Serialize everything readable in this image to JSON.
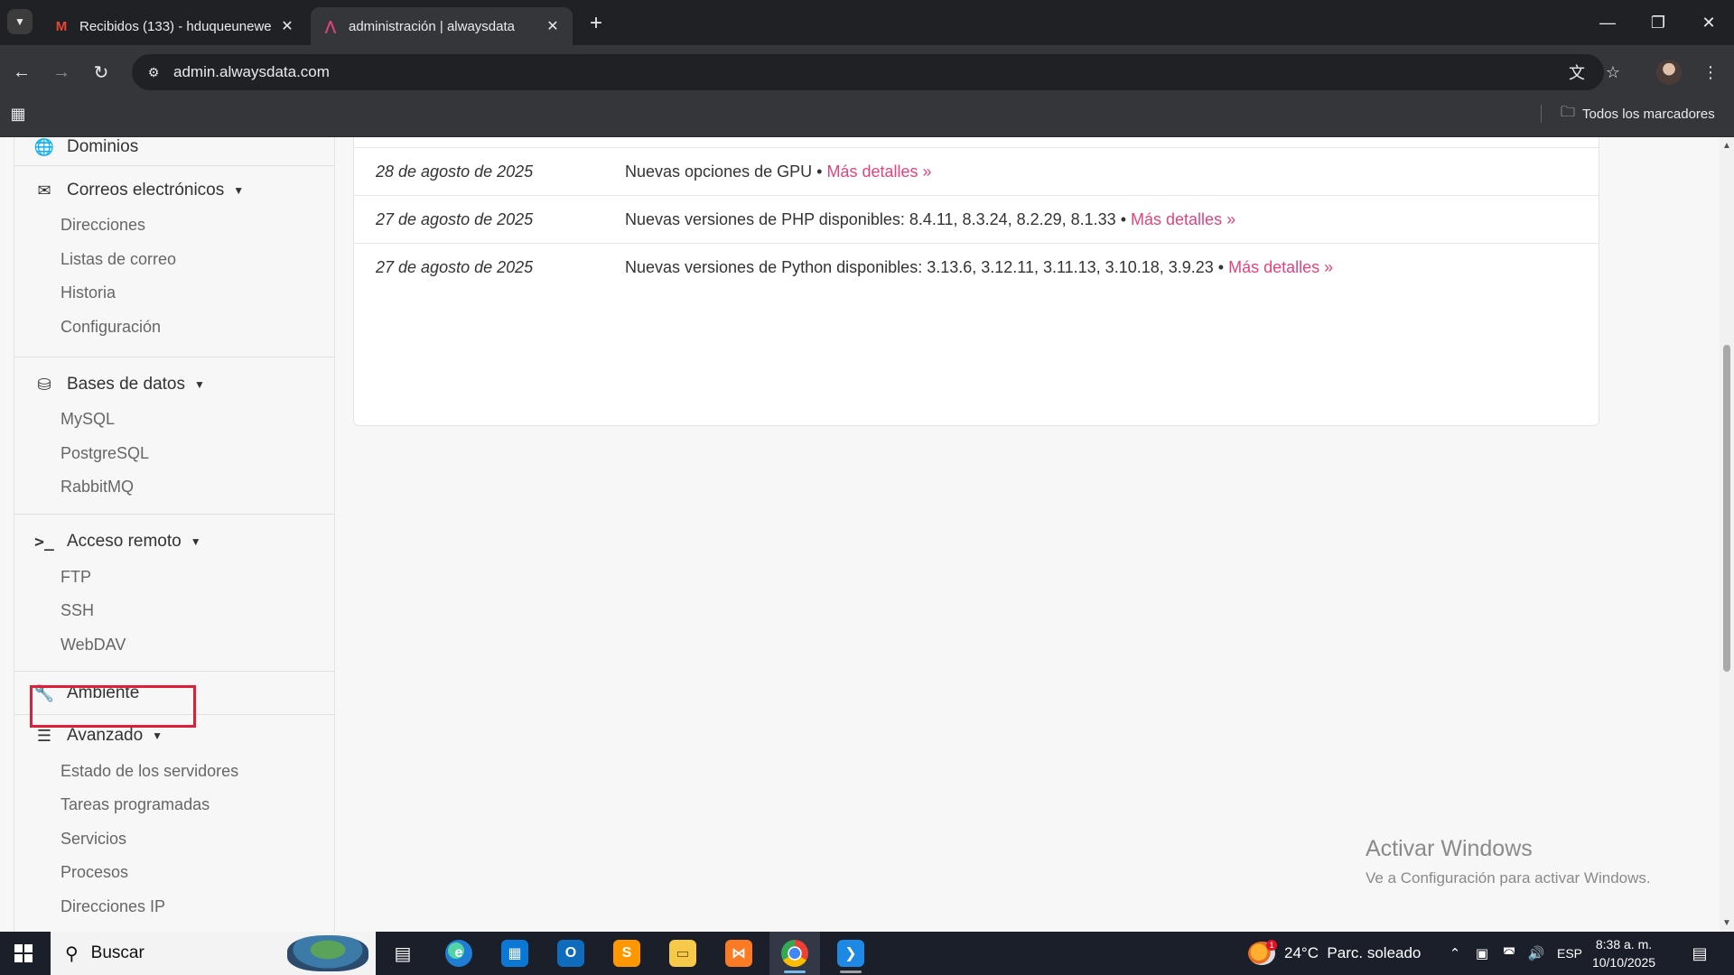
{
  "browser": {
    "tabs": [
      {
        "title": "Recibidos (133) - hduqueunewe",
        "favicon": "M",
        "active": false
      },
      {
        "title": "administración | alwaysdata",
        "favicon": "⋀",
        "active": true
      }
    ],
    "url": "admin.alwaysdata.com",
    "bookmarks_all_label": "Todos los marcadores"
  },
  "sidebar": {
    "sections": [
      {
        "label": "Dominios",
        "icon": "globe-icon",
        "items": []
      },
      {
        "label": "Correos electrónicos",
        "icon": "envelope-icon",
        "items": [
          "Direcciones",
          "Listas de correo",
          "Historia",
          "Configuración"
        ]
      },
      {
        "label": "Bases de datos",
        "icon": "database-icon",
        "items": [
          "MySQL",
          "PostgreSQL",
          "RabbitMQ"
        ]
      },
      {
        "label": "Acceso remoto",
        "icon": "terminal-icon",
        "items": [
          "FTP",
          "SSH",
          "WebDAV"
        ]
      },
      {
        "label": "Ambiente",
        "icon": "wrench-icon",
        "items": []
      },
      {
        "label": "Avanzado",
        "icon": "server-icon",
        "items": [
          "Estado de los servidores",
          "Tareas programadas",
          "Servicios",
          "Procesos",
          "Direcciones IP"
        ]
      }
    ],
    "highlighted_item": "FTP"
  },
  "news": [
    {
      "date": "28 de agosto de 2025",
      "text": "Nuevas opciones de GPU •",
      "more": "Más detalles »"
    },
    {
      "date": "27 de agosto de 2025",
      "text": "Nuevas versiones de PHP disponibles: 8.4.11, 8.3.24, 8.2.29, 8.1.33 •",
      "more": "Más detalles »"
    },
    {
      "date": "27 de agosto de 2025",
      "text": "Nuevas versiones de Python disponibles: 3.13.6, 3.12.11, 3.11.13, 3.10.18, 3.9.23 •",
      "more": "Más detalles »"
    }
  ],
  "watermark": {
    "line1": "Activar Windows",
    "line2": "Ve a Configuración para activar Windows."
  },
  "taskbar": {
    "search_label": "Buscar",
    "weather": "24°C  Parc. soleado",
    "weather_badge": "1",
    "language": "ESP",
    "time": "8:38 a. m.",
    "date": "10/10/2025"
  },
  "colors": {
    "accent_link": "#e2437d",
    "highlight_box": "#e01e37"
  }
}
